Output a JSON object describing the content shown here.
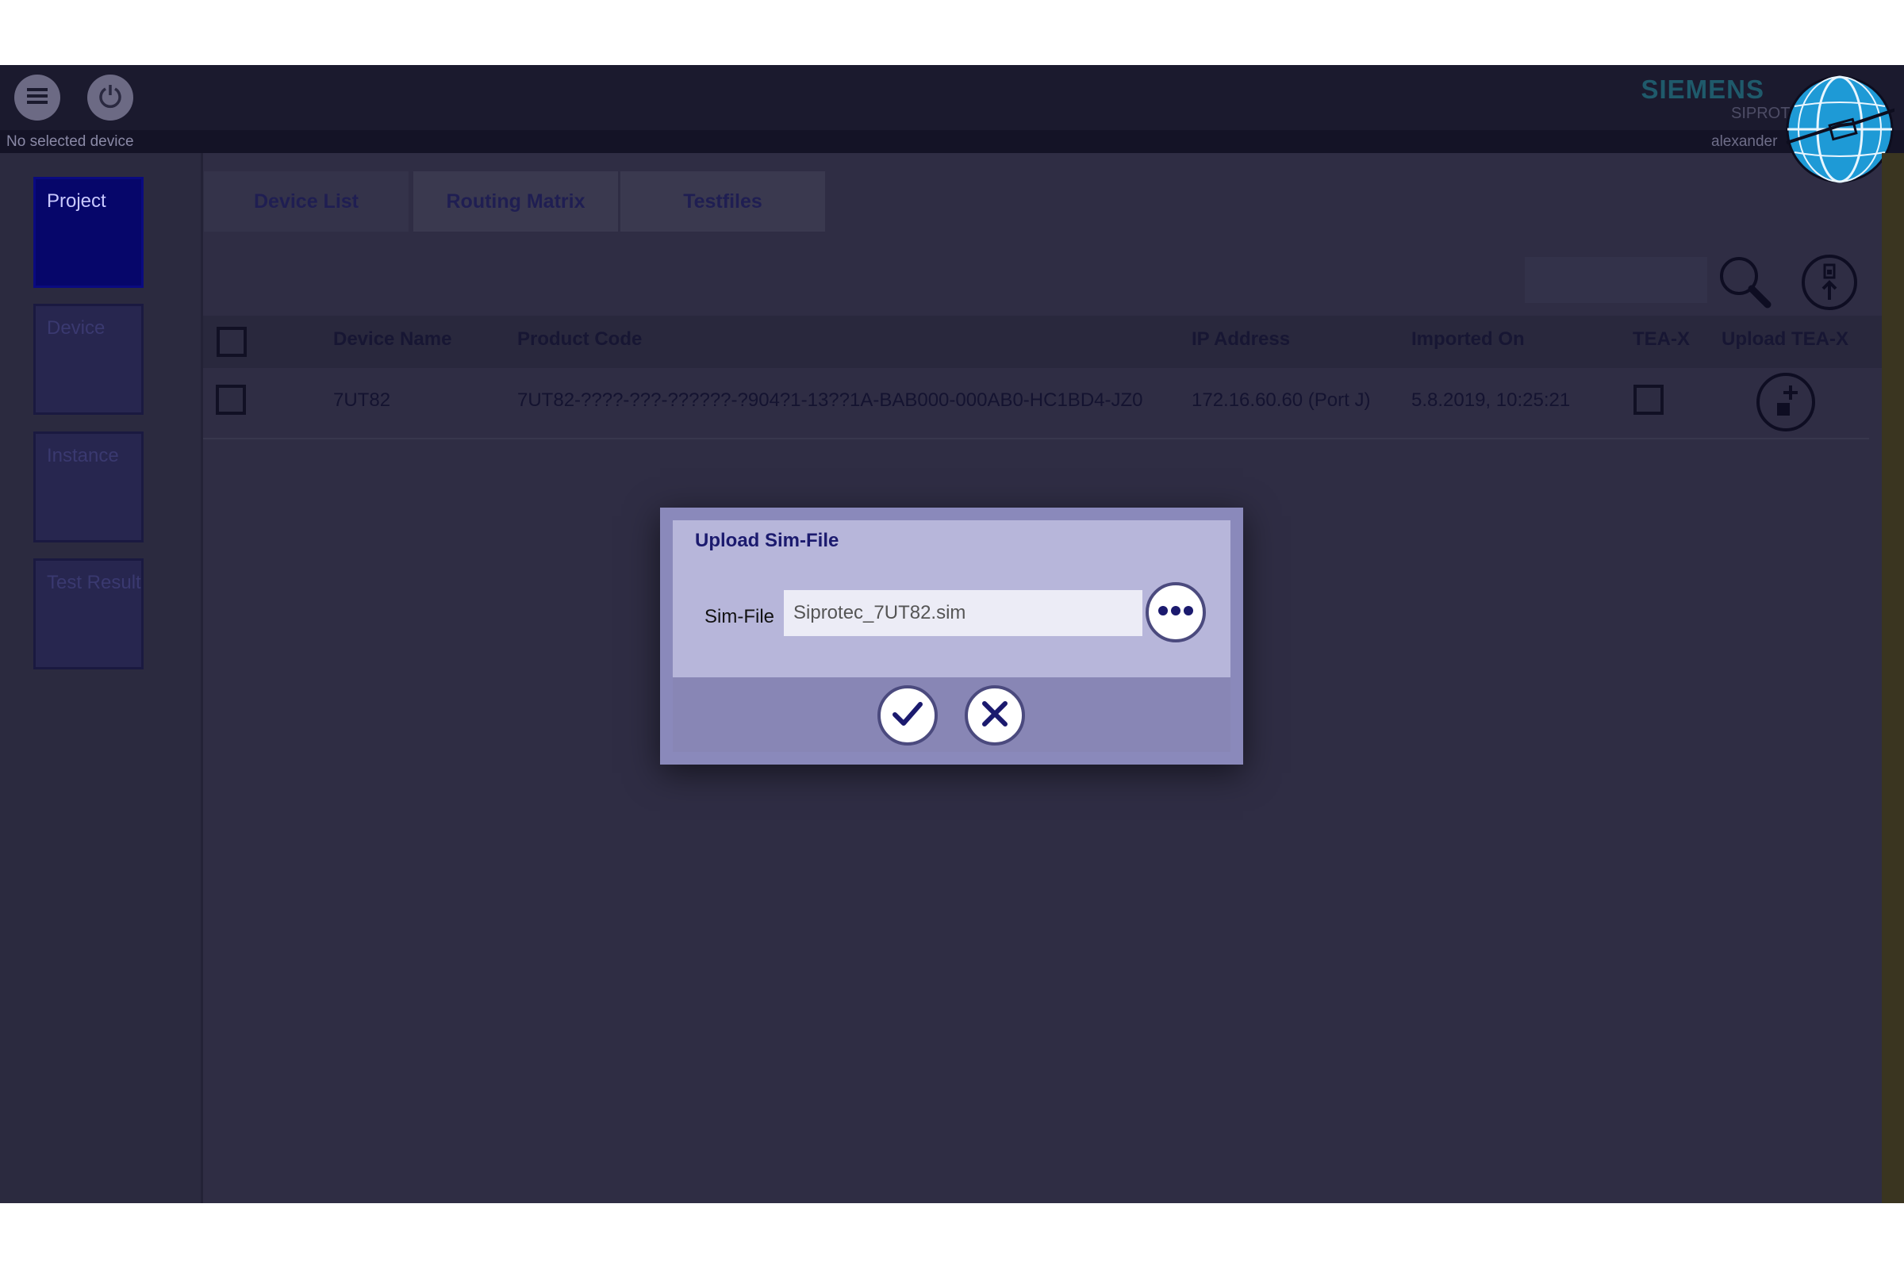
{
  "header": {
    "brand": "SIEMENS",
    "product_short": "SIPROT",
    "user_short": "alexander",
    "status": "No selected device",
    "menu_icon": "hamburger-icon",
    "power_icon": "power-icon"
  },
  "sidebar": {
    "items": [
      {
        "label": "Project"
      },
      {
        "label": "Device"
      },
      {
        "label": "Instance"
      },
      {
        "label": "Test Result"
      }
    ]
  },
  "tabs": [
    {
      "label": "Device List"
    },
    {
      "label": "Routing Matrix"
    },
    {
      "label": "Testfiles"
    }
  ],
  "table": {
    "columns": [
      "Device Name",
      "Product Code",
      "IP Address",
      "Imported On",
      "TEA-X",
      "Upload TEA-X"
    ],
    "rows": [
      {
        "device_name": "7UT82",
        "product_code": "7UT82-????-???-??????-?904?1-13??1A-BAB000-000AB0-HC1BD4-JZ0",
        "ip_address": "172.16.60.60 (Port J)",
        "imported_on": "5.8.2019, 10:25:21"
      }
    ]
  },
  "dialog": {
    "title": "Upload Sim-File",
    "field_label": "Sim-File",
    "field_value": "Siprotec_7UT82.sim"
  },
  "colors": {
    "app_bg": "#2f2d44",
    "dialog_bg": "#b7b6da",
    "accent": "#1b1a6e"
  }
}
